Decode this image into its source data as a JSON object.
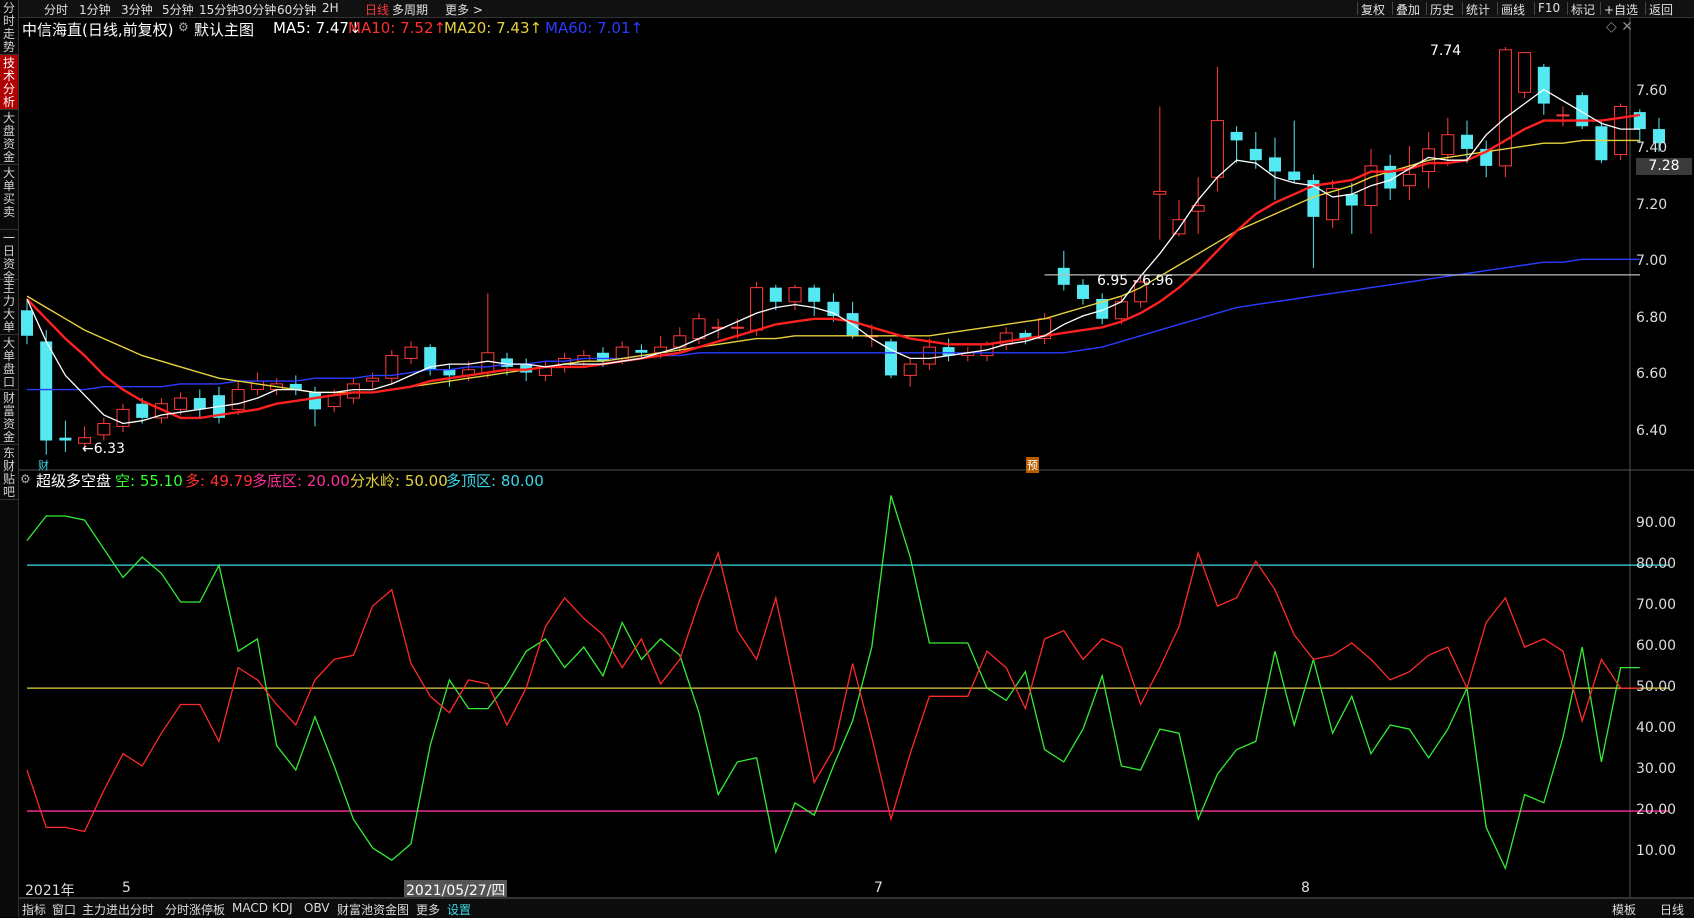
{
  "app": {
    "left_tabs": [
      {
        "label": "分时走势",
        "active": false
      },
      {
        "label": "技术分析",
        "active": true
      },
      {
        "label": "大盘资金",
        "active": false
      },
      {
        "label": "大单买卖",
        "active": false
      },
      {
        "label": "一日资金",
        "active": false
      },
      {
        "label": "主力大单",
        "active": false
      },
      {
        "label": "大单盘口",
        "active": false
      },
      {
        "label": "财富资金",
        "active": false
      },
      {
        "label": "东财贴吧",
        "active": false
      }
    ],
    "period_tabs": [
      {
        "label": "分时"
      },
      {
        "label": "1分钟"
      },
      {
        "label": "3分钟"
      },
      {
        "label": "5分钟"
      },
      {
        "label": "15分钟"
      },
      {
        "label": "30分钟"
      },
      {
        "label": "60分钟"
      },
      {
        "label": "2H"
      },
      {
        "label": "日线",
        "active": true
      },
      {
        "label": "多周期"
      },
      {
        "label": "更多 >"
      }
    ],
    "right_tools": [
      "复权",
      "叠加",
      "历史",
      "统计",
      "画线",
      "F10",
      "标记",
      "+自选",
      "返回"
    ],
    "bottom_tabs": [
      {
        "label": "指标"
      },
      {
        "label": "窗口"
      },
      {
        "label": "主力进出分时"
      },
      {
        "label": "分时涨停板"
      },
      {
        "label": "MACD"
      },
      {
        "label": "KDJ"
      },
      {
        "label": "OBV"
      },
      {
        "label": "财富池资金图"
      },
      {
        "label": "更多"
      },
      {
        "label": "设置",
        "active": true
      }
    ],
    "bottom_right": [
      "模板",
      "日线"
    ]
  },
  "main": {
    "stock_title": "中信海直(日线,前复权)",
    "template": "默认主图",
    "ma5": "MA5: 7.47↓",
    "ma10": "MA10: 7.52↑",
    "ma20": "MA20: 7.43↑",
    "ma60": "MA60: 7.01↑",
    "current_price": "7.28",
    "high_annotation": "7.74",
    "low_annotation": "←6.33",
    "range_annotation": "6.95 - 6.96",
    "tag_cai": "财",
    "tag_yu": "预",
    "y_ticks": [
      "7.60",
      "7.40",
      "7.20",
      "7.00",
      "6.80",
      "6.60",
      "6.40"
    ],
    "colors": {
      "up": "#ff3b3b",
      "down": "#54e8f2",
      "ma5": "#ffffff",
      "ma10": "#ff2020",
      "ma20": "#e6d23c",
      "ma60": "#2a3cff"
    }
  },
  "indicator": {
    "name": "超级多空盘",
    "kong": "空: 55.10",
    "duo": "多: 49.79",
    "bottom_zone": "多底区: 20.00",
    "watershed": "分水岭: 50.00",
    "top_zone": "多顶区: 80.00",
    "y_ticks": [
      "90.00",
      "80.00",
      "70.00",
      "60.00",
      "50.00",
      "40.00",
      "30.00",
      "20.00",
      "10.00"
    ]
  },
  "x_axis": {
    "labels": [
      {
        "text": "2021年",
        "hl": false
      },
      {
        "text": "5",
        "hl": false
      },
      {
        "text": "2021/05/27/四",
        "hl": true
      },
      {
        "text": "7",
        "hl": false
      },
      {
        "text": "8",
        "hl": false
      }
    ]
  },
  "chart_data": {
    "type": "candlestick",
    "ylim": [
      6.28,
      7.82
    ],
    "candles": [
      [
        6.83,
        6.74,
        6.87,
        6.71
      ],
      [
        6.72,
        6.37,
        6.76,
        6.32
      ],
      [
        6.38,
        6.37,
        6.44,
        6.33
      ],
      [
        6.36,
        6.38,
        6.42,
        6.33
      ],
      [
        6.39,
        6.43,
        6.45,
        6.37
      ],
      [
        6.42,
        6.48,
        6.5,
        6.4
      ],
      [
        6.5,
        6.45,
        6.52,
        6.43
      ],
      [
        6.45,
        6.5,
        6.52,
        6.43
      ],
      [
        6.48,
        6.52,
        6.54,
        6.46
      ],
      [
        6.52,
        6.48,
        6.55,
        6.45
      ],
      [
        6.53,
        6.45,
        6.56,
        6.43
      ],
      [
        6.48,
        6.55,
        6.58,
        6.46
      ],
      [
        6.55,
        6.58,
        6.61,
        6.53
      ],
      [
        6.55,
        6.57,
        6.59,
        6.53
      ],
      [
        6.57,
        6.55,
        6.6,
        6.53
      ],
      [
        6.54,
        6.48,
        6.56,
        6.42
      ],
      [
        6.49,
        6.53,
        6.55,
        6.47
      ],
      [
        6.52,
        6.57,
        6.59,
        6.5
      ],
      [
        6.58,
        6.59,
        6.61,
        6.55
      ],
      [
        6.59,
        6.67,
        6.69,
        6.57
      ],
      [
        6.66,
        6.7,
        6.72,
        6.64
      ],
      [
        6.7,
        6.62,
        6.71,
        6.6
      ],
      [
        6.62,
        6.6,
        6.64,
        6.56
      ],
      [
        6.6,
        6.62,
        6.65,
        6.58
      ],
      [
        6.61,
        6.68,
        6.89,
        6.59
      ],
      [
        6.66,
        6.63,
        6.68,
        6.6
      ],
      [
        6.64,
        6.61,
        6.66,
        6.58
      ],
      [
        6.6,
        6.63,
        6.65,
        6.58
      ],
      [
        6.63,
        6.66,
        6.68,
        6.61
      ],
      [
        6.65,
        6.67,
        6.69,
        6.63
      ],
      [
        6.68,
        6.65,
        6.7,
        6.63
      ],
      [
        6.66,
        6.7,
        6.72,
        6.64
      ],
      [
        6.69,
        6.68,
        6.71,
        6.66
      ],
      [
        6.68,
        6.7,
        6.74,
        6.66
      ],
      [
        6.7,
        6.74,
        6.77,
        6.68
      ],
      [
        6.73,
        6.8,
        6.82,
        6.71
      ],
      [
        6.77,
        6.77,
        6.8,
        6.73
      ],
      [
        6.77,
        6.77,
        6.8,
        6.73
      ],
      [
        6.76,
        6.91,
        6.93,
        6.74
      ],
      [
        6.91,
        6.86,
        6.92,
        6.83
      ],
      [
        6.86,
        6.91,
        6.92,
        6.83
      ],
      [
        6.91,
        6.86,
        6.92,
        6.81
      ],
      [
        6.86,
        6.81,
        6.89,
        6.79
      ],
      [
        6.82,
        6.74,
        6.86,
        6.73
      ],
      [
        6.74,
        6.74,
        6.78,
        6.7
      ],
      [
        6.72,
        6.6,
        6.73,
        6.59
      ],
      [
        6.6,
        6.64,
        6.66,
        6.56
      ],
      [
        6.64,
        6.7,
        6.73,
        6.62
      ],
      [
        6.7,
        6.67,
        6.73,
        6.65
      ],
      [
        6.67,
        6.68,
        6.7,
        6.65
      ],
      [
        6.67,
        6.71,
        6.72,
        6.65
      ],
      [
        6.71,
        6.75,
        6.77,
        6.69
      ],
      [
        6.75,
        6.73,
        6.76,
        6.71
      ],
      [
        6.73,
        6.8,
        6.82,
        6.71
      ],
      [
        6.98,
        6.92,
        7.04,
        6.9
      ],
      [
        6.92,
        6.87,
        6.94,
        6.85
      ],
      [
        6.87,
        6.8,
        6.89,
        6.78
      ],
      [
        6.8,
        6.86,
        6.88,
        6.78
      ],
      [
        6.86,
        6.93,
        6.95,
        6.84
      ],
      [
        7.24,
        7.25,
        7.55,
        7.08
      ],
      [
        7.1,
        7.15,
        7.22,
        7.09
      ],
      [
        7.18,
        7.2,
        7.3,
        7.1
      ],
      [
        7.3,
        7.5,
        7.69,
        7.25
      ],
      [
        7.46,
        7.43,
        7.48,
        7.35
      ],
      [
        7.4,
        7.36,
        7.46,
        7.33
      ],
      [
        7.37,
        7.32,
        7.44,
        7.22
      ],
      [
        7.32,
        7.29,
        7.5,
        7.28
      ],
      [
        7.29,
        7.16,
        7.31,
        6.98
      ],
      [
        7.15,
        7.26,
        7.29,
        7.12
      ],
      [
        7.24,
        7.2,
        7.28,
        7.1
      ],
      [
        7.2,
        7.34,
        7.4,
        7.1
      ],
      [
        7.34,
        7.26,
        7.38,
        7.22
      ],
      [
        7.27,
        7.31,
        7.41,
        7.22
      ],
      [
        7.32,
        7.4,
        7.46,
        7.26
      ],
      [
        7.38,
        7.45,
        7.51,
        7.34
      ],
      [
        7.45,
        7.4,
        7.5,
        7.35
      ],
      [
        7.4,
        7.34,
        7.43,
        7.3
      ],
      [
        7.34,
        7.75,
        7.76,
        7.3
      ],
      [
        7.6,
        7.74,
        7.74,
        7.58
      ],
      [
        7.69,
        7.56,
        7.7,
        7.52
      ],
      [
        7.52,
        7.52,
        7.55,
        7.48
      ],
      [
        7.59,
        7.48,
        7.6,
        7.47
      ],
      [
        7.48,
        7.36,
        7.5,
        7.35
      ],
      [
        7.38,
        7.55,
        7.56,
        7.36
      ],
      [
        7.53,
        7.47,
        7.54,
        7.42
      ],
      [
        7.47,
        7.42,
        7.51,
        7.39
      ]
    ],
    "ma5": [
      6.87,
      6.72,
      6.6,
      6.53,
      6.46,
      6.43,
      6.44,
      6.46,
      6.47,
      6.48,
      6.49,
      6.5,
      6.52,
      6.55,
      6.55,
      6.54,
      6.54,
      6.55,
      6.55,
      6.57,
      6.6,
      6.63,
      6.64,
      6.64,
      6.65,
      6.64,
      6.64,
      6.63,
      6.64,
      6.64,
      6.64,
      6.65,
      6.66,
      6.68,
      6.7,
      6.73,
      6.76,
      6.79,
      6.82,
      6.84,
      6.85,
      6.84,
      6.82,
      6.78,
      6.73,
      6.69,
      6.66,
      6.66,
      6.67,
      6.68,
      6.69,
      6.71,
      6.72,
      6.74,
      6.78,
      6.81,
      6.83,
      6.86,
      6.95,
      7.03,
      7.12,
      7.22,
      7.3,
      7.36,
      7.35,
      7.3,
      7.28,
      7.27,
      7.23,
      7.24,
      7.27,
      7.29,
      7.33,
      7.37,
      7.36,
      7.36,
      7.45,
      7.51,
      7.56,
      7.61,
      7.57,
      7.53,
      7.49,
      7.47,
      7.47
    ],
    "ma10": [
      6.87,
      6.8,
      6.73,
      6.67,
      6.6,
      6.55,
      6.51,
      6.48,
      6.45,
      6.45,
      6.46,
      6.47,
      6.48,
      6.5,
      6.51,
      6.52,
      6.53,
      6.54,
      6.54,
      6.55,
      6.56,
      6.58,
      6.59,
      6.6,
      6.61,
      6.62,
      6.62,
      6.63,
      6.63,
      6.63,
      6.64,
      6.65,
      6.66,
      6.67,
      6.68,
      6.7,
      6.72,
      6.74,
      6.76,
      6.78,
      6.79,
      6.8,
      6.8,
      6.79,
      6.77,
      6.75,
      6.73,
      6.72,
      6.71,
      6.71,
      6.71,
      6.72,
      6.73,
      6.74,
      6.75,
      6.76,
      6.77,
      6.79,
      6.82,
      6.86,
      6.91,
      6.97,
      7.04,
      7.11,
      7.17,
      7.21,
      7.24,
      7.27,
      7.28,
      7.29,
      7.32,
      7.32,
      7.33,
      7.35,
      7.35,
      7.36,
      7.39,
      7.43,
      7.47,
      7.5,
      7.5,
      7.5,
      7.5,
      7.51,
      7.52
    ],
    "ma20": [
      6.88,
      6.84,
      6.8,
      6.76,
      6.73,
      6.7,
      6.67,
      6.65,
      6.63,
      6.61,
      6.59,
      6.58,
      6.57,
      6.56,
      6.55,
      6.54,
      6.54,
      6.54,
      6.54,
      6.55,
      6.56,
      6.57,
      6.58,
      6.59,
      6.6,
      6.61,
      6.62,
      6.63,
      6.64,
      6.65,
      6.65,
      6.66,
      6.67,
      6.68,
      6.69,
      6.7,
      6.71,
      6.72,
      6.73,
      6.73,
      6.74,
      6.74,
      6.74,
      6.74,
      6.74,
      6.74,
      6.74,
      6.74,
      6.75,
      6.76,
      6.77,
      6.78,
      6.79,
      6.8,
      6.82,
      6.84,
      6.86,
      6.88,
      6.91,
      6.95,
      6.99,
      7.03,
      7.07,
      7.11,
      7.14,
      7.17,
      7.2,
      7.23,
      7.25,
      7.27,
      7.3,
      7.32,
      7.34,
      7.36,
      7.37,
      7.38,
      7.39,
      7.4,
      7.41,
      7.42,
      7.42,
      7.43,
      7.43,
      7.43,
      7.43
    ],
    "ma60": [
      6.55,
      6.55,
      6.55,
      6.55,
      6.56,
      6.56,
      6.56,
      6.56,
      6.57,
      6.57,
      6.57,
      6.58,
      6.58,
      6.58,
      6.58,
      6.59,
      6.59,
      6.59,
      6.6,
      6.6,
      6.61,
      6.62,
      6.62,
      6.63,
      6.63,
      6.64,
      6.64,
      6.65,
      6.65,
      6.66,
      6.66,
      6.66,
      6.67,
      6.67,
      6.67,
      6.68,
      6.68,
      6.68,
      6.68,
      6.68,
      6.68,
      6.68,
      6.68,
      6.68,
      6.68,
      6.68,
      6.68,
      6.68,
      6.68,
      6.68,
      6.68,
      6.68,
      6.68,
      6.68,
      6.68,
      6.69,
      6.7,
      6.72,
      6.74,
      6.76,
      6.78,
      6.8,
      6.82,
      6.84,
      6.85,
      6.86,
      6.87,
      6.88,
      6.89,
      6.9,
      6.91,
      6.92,
      6.93,
      6.94,
      6.95,
      6.96,
      6.97,
      6.98,
      6.99,
      7.0,
      7.0,
      7.01,
      7.01,
      7.01,
      7.01
    ],
    "indicator_series": [
      {
        "name": "空",
        "values": [
          86,
          92,
          92,
          91,
          84,
          77,
          82,
          78,
          71,
          71,
          80,
          59,
          62,
          36,
          30,
          43,
          31,
          18,
          11,
          8,
          12,
          36,
          52,
          45,
          45,
          51,
          59,
          62,
          55,
          60,
          53,
          66,
          57,
          62,
          58,
          44,
          24,
          32,
          33,
          10,
          22,
          19,
          31,
          42,
          60,
          97,
          82,
          61,
          61,
          61,
          50,
          47,
          54,
          35,
          32,
          40,
          53,
          31,
          30,
          40,
          39,
          18,
          29,
          35,
          37,
          59,
          41,
          57,
          39,
          48,
          34,
          41,
          40,
          33,
          40,
          50,
          16,
          6,
          24,
          22,
          38,
          60,
          32,
          55,
          55
        ]
      },
      {
        "name": "多",
        "values": [
          30,
          16,
          16,
          15,
          25,
          34,
          31,
          39,
          46,
          46,
          37,
          55,
          52,
          46,
          41,
          52,
          57,
          58,
          70,
          74,
          56,
          48,
          44,
          52,
          51,
          41,
          50,
          65,
          72,
          67,
          63,
          55,
          62,
          51,
          57,
          71,
          83,
          64,
          57,
          72,
          50,
          27,
          35,
          56,
          38,
          18,
          34,
          48,
          48,
          48,
          59,
          55,
          45,
          62,
          64,
          57,
          62,
          60,
          46,
          55,
          65,
          83,
          70,
          72,
          81,
          74,
          63,
          57,
          58,
          61,
          57,
          52,
          54,
          58,
          60,
          50,
          66,
          72,
          60,
          62,
          59,
          42,
          57,
          50,
          50
        ]
      }
    ]
  }
}
